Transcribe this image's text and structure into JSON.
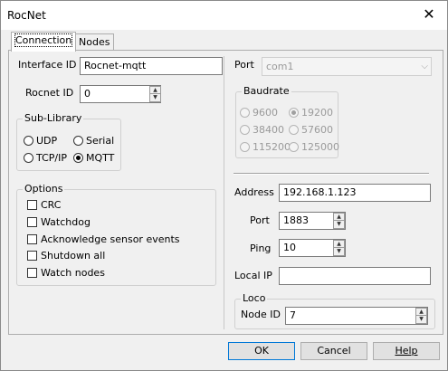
{
  "window": {
    "title": "RocNet"
  },
  "tabs": [
    {
      "label": "Connection"
    },
    {
      "label": "Nodes"
    }
  ],
  "interface_id": {
    "label": "Interface ID",
    "value": "Rocnet-mqtt"
  },
  "rocnet_id": {
    "label": "Rocnet ID",
    "value": "0"
  },
  "sub_library": {
    "legend": "Sub-Library",
    "options": [
      "UDP",
      "Serial",
      "TCP/IP",
      "MQTT"
    ],
    "selected": "MQTT"
  },
  "options_group": {
    "legend": "Options",
    "items": [
      "CRC",
      "Watchdog",
      "Acknowledge sensor events",
      "Shutdown all",
      "Watch nodes"
    ]
  },
  "port_select": {
    "label": "Port",
    "value": "com1"
  },
  "baudrate": {
    "legend": "Baudrate",
    "options": [
      "9600",
      "19200",
      "38400",
      "57600",
      "115200",
      "125000"
    ],
    "selected": "19200"
  },
  "address": {
    "label": "Address",
    "value": "192.168.1.123"
  },
  "net_port": {
    "label": "Port",
    "value": "1883"
  },
  "ping": {
    "label": "Ping",
    "value": "10"
  },
  "local_ip": {
    "label": "Local IP",
    "value": ""
  },
  "loco": {
    "legend": "Loco",
    "node_id_label": "Node ID",
    "node_id_value": "7"
  },
  "buttons": {
    "ok": "OK",
    "cancel": "Cancel",
    "help": "Help"
  },
  "icons": {
    "close": "close-icon",
    "dropdown": "chevron-down-icon",
    "spin_up": "triangle-up-icon",
    "spin_down": "triangle-down-icon"
  }
}
